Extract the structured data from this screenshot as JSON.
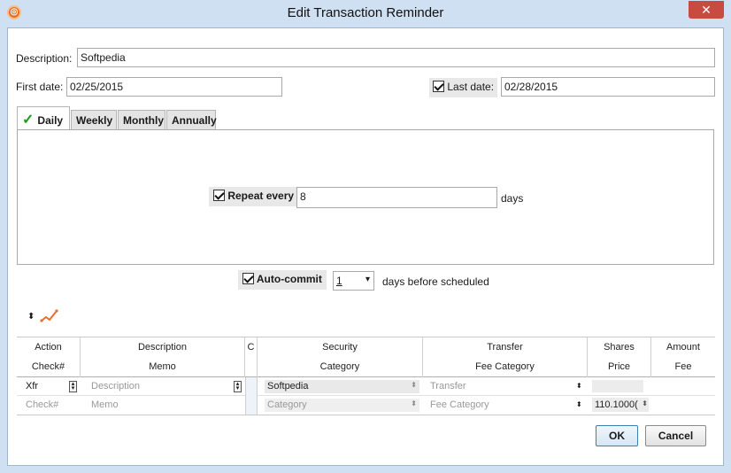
{
  "window": {
    "title": "Edit Transaction Reminder",
    "close_glyph": "✕"
  },
  "form": {
    "description_label": "Description:",
    "description_value": "Softpedia",
    "first_date_label": "First date:",
    "first_date_value": "02/25/2015",
    "last_date_label": "Last date:",
    "last_date_value": "02/28/2015",
    "last_date_checked": true
  },
  "tabs": [
    {
      "label": "Daily",
      "active": true
    },
    {
      "label": "Weekly",
      "active": false
    },
    {
      "label": "Monthly",
      "active": false
    },
    {
      "label": "Annually",
      "active": false
    }
  ],
  "daily": {
    "repeat_label": "Repeat every",
    "repeat_value": "8",
    "unit_label": "days",
    "checked": true
  },
  "autocommit": {
    "label": "Auto-commit",
    "checked": true,
    "days_value": "1",
    "suffix": "days before scheduled"
  },
  "grid": {
    "headers_top": [
      "Action",
      "Description",
      "C",
      "Security",
      "Transfer",
      "Shares",
      "Amount"
    ],
    "headers_bottom": [
      "Check#",
      "Memo",
      "",
      "Category",
      "Fee Category",
      "Price",
      "Fee"
    ],
    "row1": {
      "action": "Xfr",
      "description_placeholder": "Description",
      "security": "Softpedia",
      "transfer_placeholder": "Transfer"
    },
    "row2": {
      "check_placeholder": "Check#",
      "memo_placeholder": "Memo",
      "category_placeholder": "Category",
      "fee_category_placeholder": "Fee Category",
      "price_value": "110.1000("
    }
  },
  "buttons": {
    "ok": "OK",
    "cancel": "Cancel"
  },
  "icons": {
    "app": "app-icon",
    "sort": "sort-arrows-icon",
    "chart": "chart-line-icon"
  },
  "colors": {
    "accent_check": "#1a9d1a",
    "titlebar": "#cfe0f3",
    "close": "#c94a40"
  }
}
